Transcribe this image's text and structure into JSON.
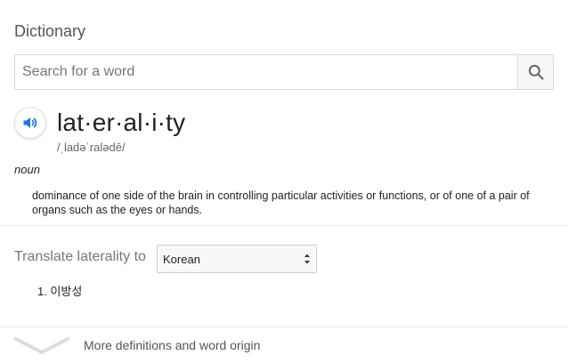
{
  "dictionary": {
    "title": "Dictionary",
    "search": {
      "placeholder": "Search for a word",
      "value": ""
    },
    "entry": {
      "headword": "lat·er·al·i·ty",
      "phonetic": "/ˌladəˈralədē/",
      "part_of_speech": "noun",
      "definition": "dominance of one side of the brain in controlling particular activities or functions, or of one of a pair of organs such as the eyes or hands."
    },
    "translate": {
      "label": "Translate laterality to",
      "selected_language": "Korean",
      "results": [
        {
          "number": "1.",
          "text": "이방성"
        }
      ]
    },
    "more_link": "More definitions and word origin"
  },
  "colors": {
    "accent_blue": "#1a73e8",
    "muted_text": "#777777",
    "border": "#d9d9d9",
    "chevron": "#dadce0"
  },
  "icons": {
    "search": "search-icon",
    "speaker": "speaker-icon",
    "select_arrows": "updown-arrows-icon",
    "expand": "chevron-down-icon"
  }
}
